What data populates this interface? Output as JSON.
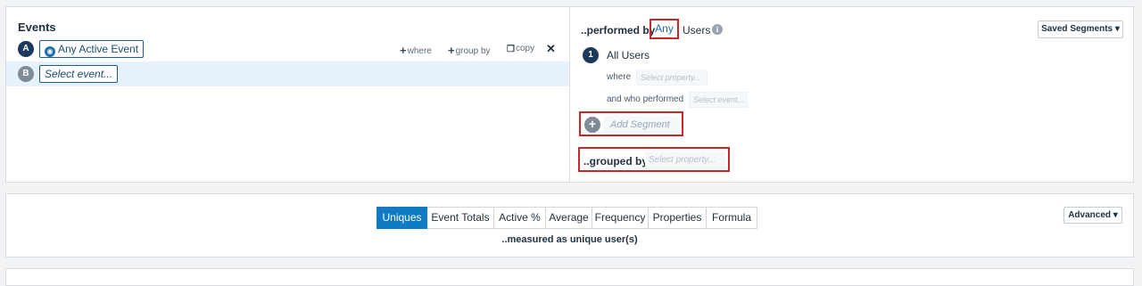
{
  "events": {
    "title": "Events",
    "rows": [
      {
        "letter": "A",
        "event_label": "Any Active Event",
        "event_icon": "globe-icon"
      },
      {
        "letter": "B",
        "event_label": "Select event..."
      }
    ],
    "actions": {
      "where": "where",
      "group_by": "group by",
      "copy": "copy",
      "close": "✕"
    }
  },
  "segments": {
    "performed_by_label": "..performed by",
    "any_label": "Any",
    "users_label": "Users",
    "info_symbol": "i",
    "saved_segments_label": "Saved Segments ▾",
    "items": [
      {
        "number": "1",
        "name": "All Users",
        "where_label": "where",
        "where_placeholder": "Select property...",
        "who_performed_label": "and who performed",
        "who_performed_placeholder": "Select event..."
      }
    ],
    "add_segment_label": "Add Segment",
    "grouped_by_label": "..grouped by",
    "grouped_by_placeholder": "Select property..."
  },
  "metrics": {
    "tabs": [
      {
        "label": "Uniques",
        "active": true
      },
      {
        "label": "Event Totals",
        "active": false
      },
      {
        "label": "Active %",
        "active": false
      },
      {
        "label": "Average",
        "active": false
      },
      {
        "label": "Frequency",
        "active": false
      },
      {
        "label": "Properties",
        "active": false
      },
      {
        "label": "Formula",
        "active": false
      }
    ],
    "measured_label": "..measured as unique user(s)",
    "advanced_label": "Advanced ▾"
  },
  "colors": {
    "accent": "#0e7bc4",
    "highlight_border": "#c62828",
    "badge_dark": "#1c3a5e"
  }
}
